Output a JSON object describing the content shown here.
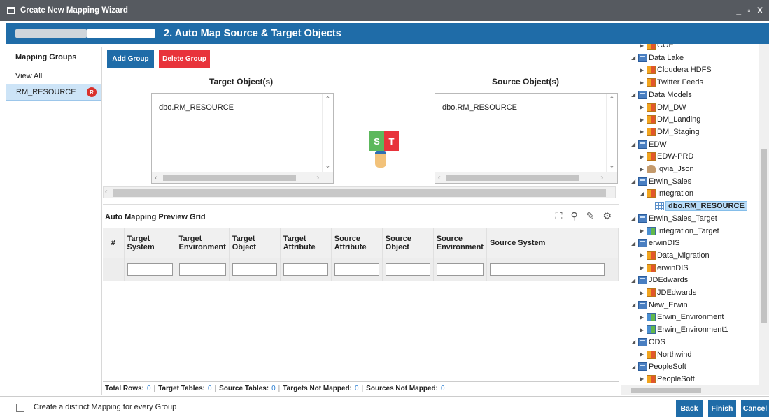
{
  "window": {
    "title": "Create New Mapping Wizard",
    "controls": "_ ▫ X"
  },
  "step": {
    "title": "2. Auto Map Source & Target Objects"
  },
  "mapping_groups": {
    "header": "Mapping Groups",
    "view_all": "View All",
    "items": [
      {
        "label": "RM_RESOURCE",
        "badge": "R"
      }
    ]
  },
  "toolbar": {
    "add_group": "Add Group",
    "delete_group": "Delete Group"
  },
  "target": {
    "label": "Target Object(s)",
    "items": [
      "dbo.RM_RESOURCE"
    ]
  },
  "source": {
    "label": "Source Object(s)",
    "items": [
      "dbo.RM_RESOURCE"
    ]
  },
  "map_icon": {
    "left": "S",
    "right": "T"
  },
  "grid": {
    "title": "Auto Mapping Preview Grid",
    "columns": [
      "#",
      "Target System",
      "Target Environment",
      "Target Object",
      "Target Attribute",
      "Source Attribute",
      "Source Object",
      "Source Environment",
      "Source System"
    ]
  },
  "stats": {
    "total_rows_label": "Total Rows:",
    "total_rows": "0",
    "target_tables_label": "Target Tables:",
    "target_tables": "0",
    "source_tables_label": "Source Tables:",
    "source_tables": "0",
    "targets_not_mapped_label": "Targets Not Mapped:",
    "targets_not_mapped": "0",
    "sources_not_mapped_label": "Sources Not Mapped:",
    "sources_not_mapped": "0"
  },
  "tree": [
    {
      "label": "COE",
      "icon": "db",
      "level": 1,
      "toggle": "▶"
    },
    {
      "label": "Data Lake",
      "icon": "server",
      "level": 0,
      "toggle": "◢"
    },
    {
      "label": "Cloudera HDFS",
      "icon": "db",
      "level": 1,
      "toggle": "▶"
    },
    {
      "label": "Twitter Feeds",
      "icon": "db",
      "level": 1,
      "toggle": "▶"
    },
    {
      "label": "Data Models",
      "icon": "server",
      "level": 0,
      "toggle": "◢"
    },
    {
      "label": "DM_DW",
      "icon": "db",
      "level": 1,
      "toggle": "▶"
    },
    {
      "label": "DM_Landing",
      "icon": "db",
      "level": 1,
      "toggle": "▶"
    },
    {
      "label": "DM_Staging",
      "icon": "db",
      "level": 1,
      "toggle": "▶"
    },
    {
      "label": "EDW",
      "icon": "server",
      "level": 0,
      "toggle": "◢"
    },
    {
      "label": "EDW-PRD",
      "icon": "db",
      "level": 1,
      "toggle": "▶"
    },
    {
      "label": "Iqvia_Json",
      "icon": "json",
      "level": 1,
      "toggle": "▶"
    },
    {
      "label": "Erwin_Sales",
      "icon": "server",
      "level": 0,
      "toggle": "◢"
    },
    {
      "label": "Integration",
      "icon": "db",
      "level": 1,
      "toggle": "◢"
    },
    {
      "label": "dbo.RM_RESOURCE",
      "icon": "tbl",
      "level": 2,
      "toggle": "",
      "selected": true
    },
    {
      "label": "Erwin_Sales_Target",
      "icon": "server",
      "level": 0,
      "toggle": "◢"
    },
    {
      "label": "Integration_Target",
      "icon": "dbg",
      "level": 1,
      "toggle": "▶"
    },
    {
      "label": "erwinDIS",
      "icon": "server",
      "level": 0,
      "toggle": "◢"
    },
    {
      "label": "Data_Migration",
      "icon": "db",
      "level": 1,
      "toggle": "▶"
    },
    {
      "label": "erwinDIS",
      "icon": "db",
      "level": 1,
      "toggle": "▶"
    },
    {
      "label": "JDEdwards",
      "icon": "server",
      "level": 0,
      "toggle": "◢"
    },
    {
      "label": "JDEdwards",
      "icon": "db",
      "level": 1,
      "toggle": "▶"
    },
    {
      "label": "New_Erwin",
      "icon": "server",
      "level": 0,
      "toggle": "◢"
    },
    {
      "label": "Erwin_Environment",
      "icon": "dbg",
      "level": 1,
      "toggle": "▶"
    },
    {
      "label": "Erwin_Environment1",
      "icon": "dbg",
      "level": 1,
      "toggle": "▶"
    },
    {
      "label": "ODS",
      "icon": "server",
      "level": 0,
      "toggle": "◢"
    },
    {
      "label": "Northwind",
      "icon": "db",
      "level": 1,
      "toggle": "▶"
    },
    {
      "label": "PeopleSoft",
      "icon": "server",
      "level": 0,
      "toggle": "◢"
    },
    {
      "label": "PeopleSoft",
      "icon": "db",
      "level": 1,
      "toggle": "▶"
    }
  ],
  "footer": {
    "checkbox_label": "Create a distinct Mapping for every Group",
    "back": "Back",
    "finish": "Finish",
    "cancel": "Cancel"
  }
}
